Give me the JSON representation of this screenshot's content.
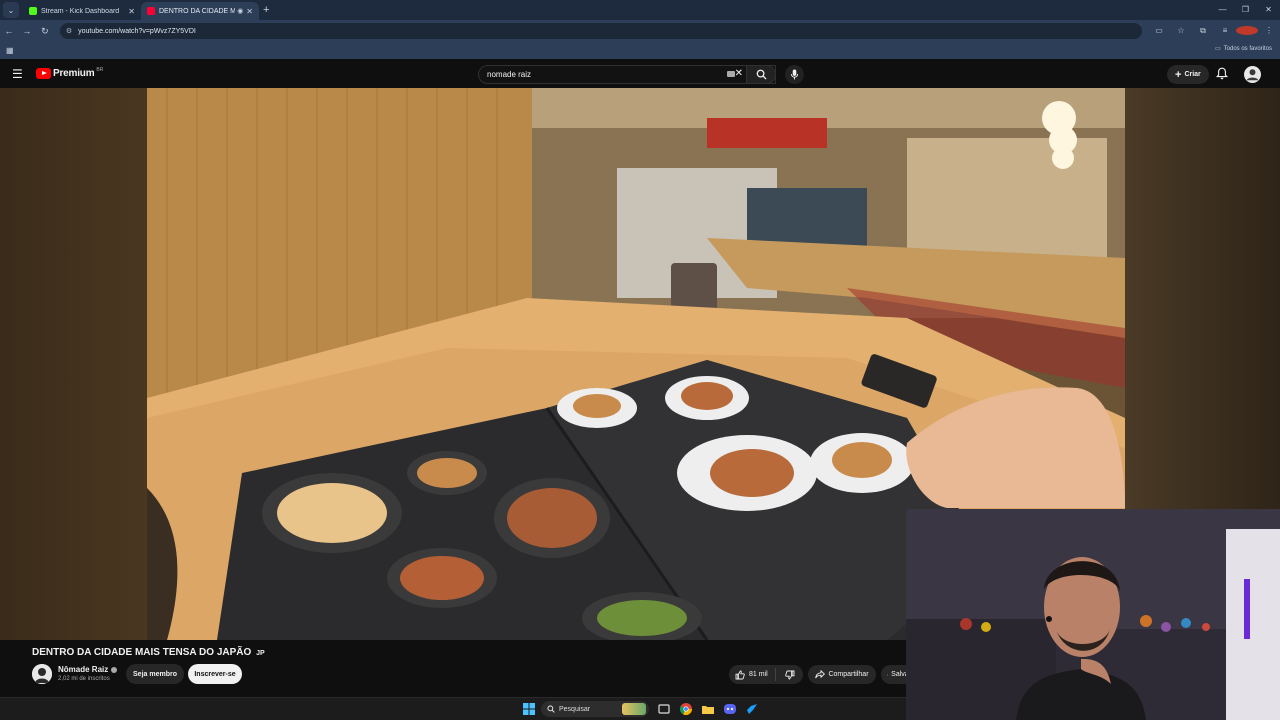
{
  "browser": {
    "tabs": [
      {
        "label": "Stream - Kick Dashboard",
        "favicon_color": "#53fc18",
        "active": false
      },
      {
        "label": "DENTRO DA CIDADE MAIS",
        "favicon_color": "#ff0033",
        "active": true
      }
    ],
    "url": "youtube.com/watch?v=pWvz7ZY5VDI",
    "bookmarks_folder": "Todos os favoritos"
  },
  "youtube": {
    "logo_text": "Premium",
    "logo_sup": "BR",
    "search_value": "nomade raiz",
    "create_label": "Criar"
  },
  "video": {
    "title": "DENTRO DA CIDADE MAIS TENSA DO JAPÃO",
    "title_tag": "JP",
    "channel_name": "Nômade Raiz",
    "subscribers": "2,02 mi de inscritos",
    "join_label": "Seja membro",
    "subscribe_label": "Inscrever-se",
    "likes": "81 mil",
    "share_label": "Compartilhar",
    "save_label": "Salvar"
  },
  "taskbar": {
    "search_placeholder": "Pesquisar"
  },
  "icons": {
    "menu": "hamburger-icon",
    "search": "search-icon",
    "mic": "mic-icon",
    "bell": "bell-icon",
    "like": "thumbs-up-icon",
    "dislike": "thumbs-down-icon",
    "share": "share-icon",
    "save": "bookmark-icon"
  }
}
